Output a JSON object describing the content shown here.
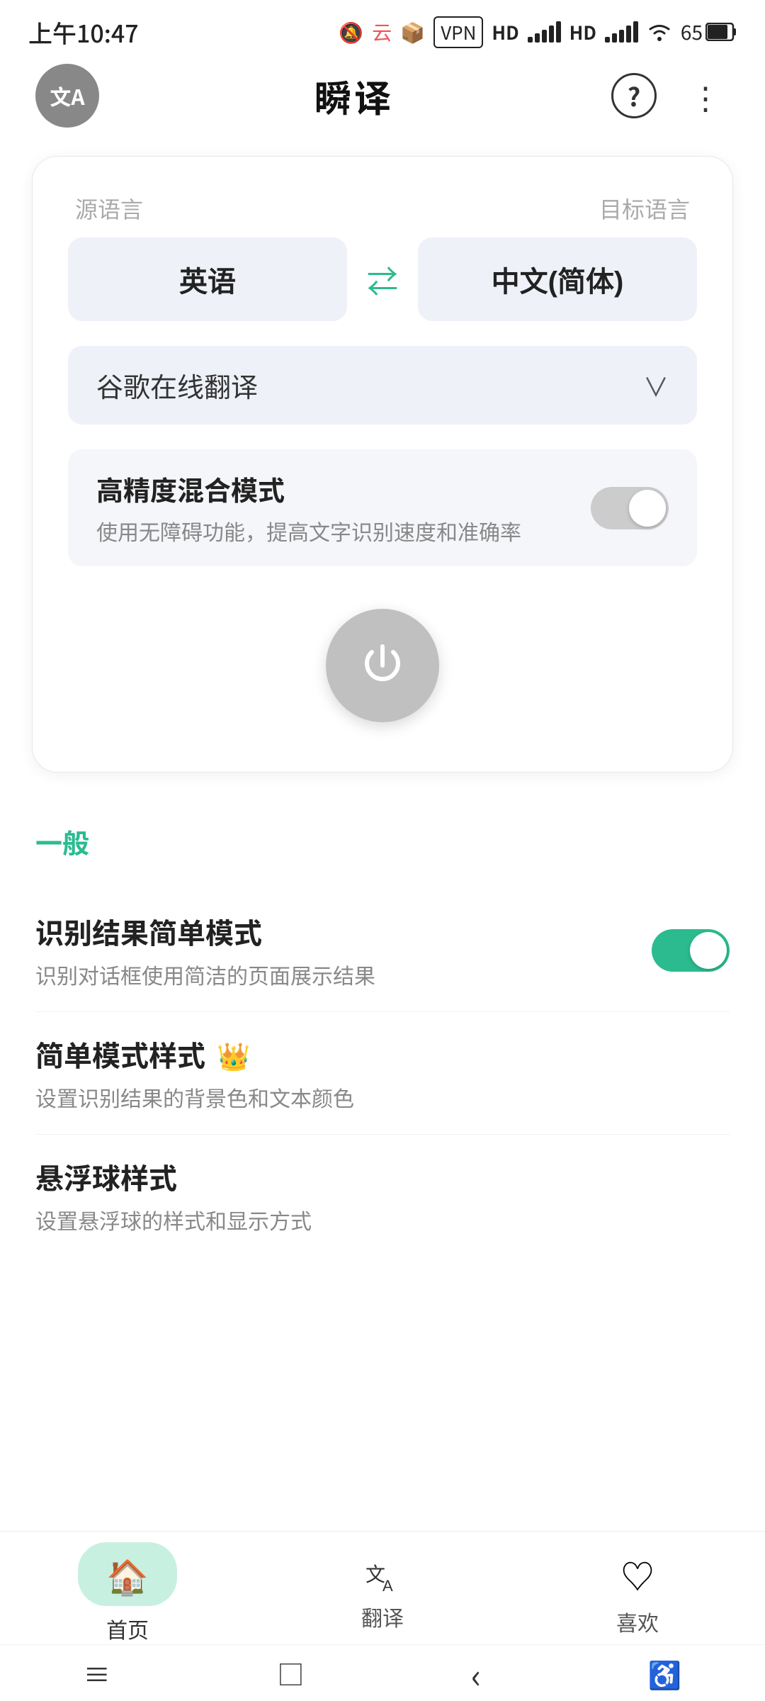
{
  "statusBar": {
    "time": "上午10:47",
    "vpn": "VPN",
    "hd1": "HD",
    "hd2": "HD",
    "battery": "65"
  },
  "appBar": {
    "logoText": "文A",
    "title": "瞬译",
    "helpLabel": "?",
    "moreLabel": "⋮"
  },
  "card": {
    "sourceLang": {
      "label": "源语言",
      "value": "英语"
    },
    "targetLang": {
      "label": "目标语言",
      "value": "中文(简体)"
    },
    "swapIcon": "⇄",
    "engine": "谷歌在线翻译",
    "highPrecision": {
      "title": "高精度混合模式",
      "subtitle": "使用无障碍功能，提高文字识别速度和准确率",
      "enabled": false
    }
  },
  "settings": {
    "sectionTitle": "一般",
    "items": [
      {
        "title": "识别结果简单模式",
        "subtitle": "识别对话框使用简洁的页面展示结果",
        "type": "toggle",
        "enabled": true,
        "hasCrown": false
      },
      {
        "title": "简单模式样式",
        "subtitle": "设置识别结果的背景色和文本颜色",
        "type": "arrow",
        "enabled": false,
        "hasCrown": true
      },
      {
        "title": "悬浮球样式",
        "subtitle": "设置悬浮球的样式和显示方式",
        "type": "arrow",
        "enabled": false,
        "hasCrown": false
      }
    ]
  },
  "bottomNav": {
    "items": [
      {
        "label": "首页",
        "icon": "🏠",
        "active": true
      },
      {
        "label": "翻译",
        "icon": "文A",
        "active": false
      },
      {
        "label": "喜欢",
        "icon": "♡",
        "active": false
      }
    ]
  },
  "sysNav": {
    "menu": "≡",
    "home": "□",
    "back": "‹",
    "accessibility": "♿"
  }
}
